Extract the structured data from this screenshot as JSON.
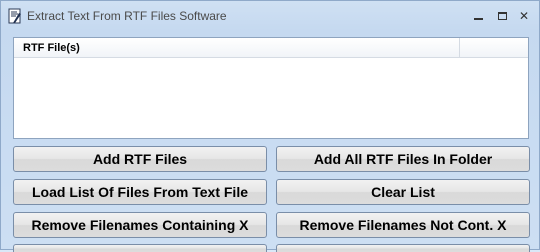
{
  "window": {
    "title": "Extract Text From RTF Files Software",
    "controls": {
      "minimize_icon": "minimize-icon",
      "maximize_icon": "maximize-icon",
      "close_icon": "close-icon",
      "close_glyph": "✕"
    }
  },
  "file_list": {
    "columns": [
      {
        "label": "RTF File(s)"
      },
      {
        "label": ""
      }
    ],
    "rows": []
  },
  "buttons": {
    "add_rtf_files": "Add RTF Files",
    "add_all_rtf_in_folder": "Add All RTF Files In Folder",
    "load_list_from_text": "Load List Of Files From Text File",
    "clear_list": "Clear List",
    "remove_containing": "Remove Filenames Containing X",
    "remove_not_containing": "Remove Filenames Not Cont. X"
  },
  "colors": {
    "window_bg": "#cddff3",
    "button_border": "#7a8ea8",
    "list_border": "#8ea4bf"
  }
}
